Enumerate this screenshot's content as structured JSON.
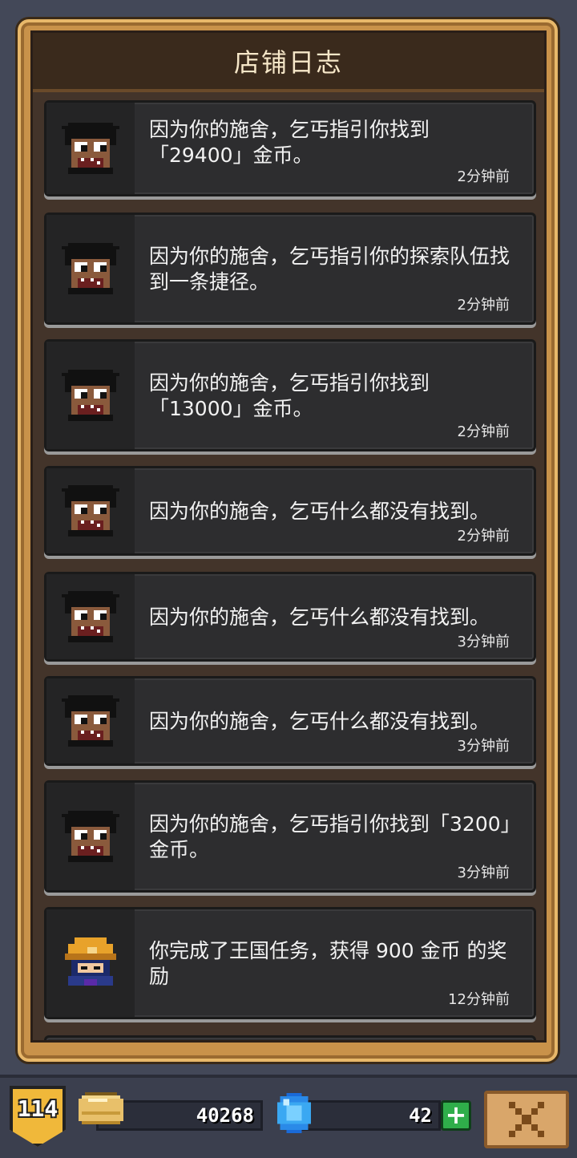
{
  "header": {
    "title": "店铺日志"
  },
  "log_entries": [
    {
      "avatar": "beggar-icon",
      "text": "因为你的施舍，乞丐指引你找到「29400」金币。",
      "time": "2分钟前"
    },
    {
      "avatar": "beggar-icon",
      "text": "因为你的施舍，乞丐指引你的探索队伍找到一条捷径。",
      "time": "2分钟前"
    },
    {
      "avatar": "beggar-icon",
      "text": "因为你的施舍，乞丐指引你找到「13000」金币。",
      "time": "2分钟前"
    },
    {
      "avatar": "beggar-icon",
      "text": "因为你的施舍，乞丐什么都没有找到。",
      "time": "2分钟前"
    },
    {
      "avatar": "beggar-icon",
      "text": "因为你的施舍，乞丐什么都没有找到。",
      "time": "3分钟前"
    },
    {
      "avatar": "beggar-icon",
      "text": "因为你的施舍，乞丐什么都没有找到。",
      "time": "3分钟前"
    },
    {
      "avatar": "beggar-icon",
      "text": "因为你的施舍，乞丐指引你找到「3200」金币。",
      "time": "3分钟前"
    },
    {
      "avatar": "knight-icon",
      "text": "你完成了王国任务，获得 900 金币 的奖励",
      "time": "12分钟前"
    }
  ],
  "status_bar": {
    "level": "114",
    "gold": "40268",
    "gems": "42"
  },
  "colors": {
    "frame_gold": "#c9924a",
    "panel_dark": "#2d2d2f",
    "background": "#434858",
    "plus_green": "#2fae4a"
  }
}
